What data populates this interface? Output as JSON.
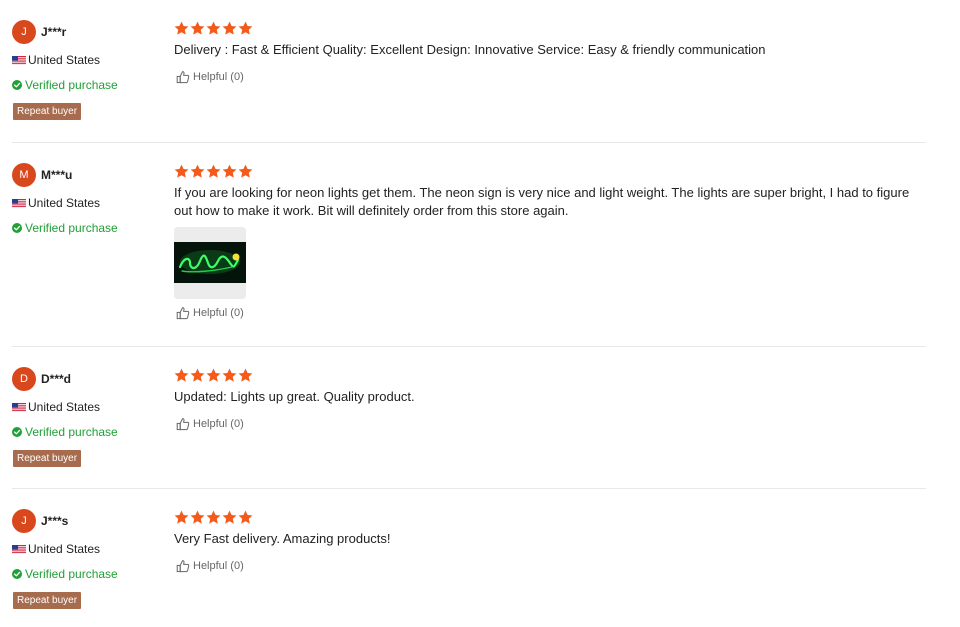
{
  "helpful_label": "Helpful (0)",
  "rating_max": 5,
  "colors": {
    "star": "#f35b1d",
    "avatar": "#d9481c",
    "verified": "#21a037",
    "repeat_badge": "#a76b4e",
    "neon": "#3dff6a"
  },
  "reviews": [
    {
      "avatar_letter": "J",
      "username": "J***r",
      "country": "United States",
      "verified": "Verified purchase",
      "repeat_buyer": "Repeat buyer",
      "rating": 5,
      "text": "Delivery : Fast & Efficient Quality:   Excellent Design:   Innovative Service:  Easy & friendly communication"
    },
    {
      "avatar_letter": "M",
      "username": "M***u",
      "country": "United States",
      "verified": "Verified purchase",
      "rating": 5,
      "text": "If you are looking for neon lights get them. The neon sign is very nice and light weight. The lights are super bright, I had to figure out how to make it work. Bit will definitely order from this store again.",
      "has_photo": true
    },
    {
      "avatar_letter": "D",
      "username": "D***d",
      "country": "United States",
      "verified": "Verified purchase",
      "repeat_buyer": "Repeat buyer",
      "rating": 5,
      "text": "Updated: Lights up great. Quality product."
    },
    {
      "avatar_letter": "J",
      "username": "J***s",
      "country": "United States",
      "verified": "Verified purchase",
      "repeat_buyer": "Repeat buyer",
      "rating": 5,
      "text": "Very Fast delivery. Amazing products!"
    }
  ]
}
